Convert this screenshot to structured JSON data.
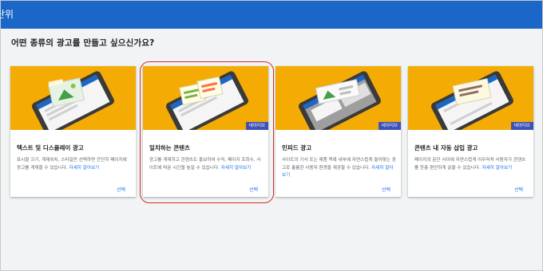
{
  "topbar": {
    "title": "단위"
  },
  "question": "어떤 종류의 광고를 만들고 싶으신가요?",
  "cards": [
    {
      "title": "텍스트 및 디스플레이 광고",
      "desc": "표시할 크기, 게재위치, 스타일만 선택하면 간단히 페이지에 광고를 게재할 수 있습니다.",
      "more": "자세히 알아보기",
      "select": "선택",
      "badge": ""
    },
    {
      "title": "일치하는 콘텐츠",
      "desc": "광고를 게재하고 콘텐츠도 홍보하여 수익, 페이지 조회수, 사이트에 머문 시간을 높일 수 있습니다.",
      "more": "자세히 알아보기",
      "select": "선택",
      "badge": "네이티브"
    },
    {
      "title": "인피드 광고",
      "desc": "사이트의 기사 또는 제품 목록 내부에 자연스럽게 들어맞는 광고로 훌륭한 사용자 환경을 제공할 수 있습니다.",
      "more": "자세히 알아보기",
      "select": "선택",
      "badge": "네이티브"
    },
    {
      "title": "콘텐츠 내 자동 삽입 광고",
      "desc": "페이지의 문단 사이에 자연스럽게 어우러져 사용자가 콘텐츠를 한층 편안하게 읽을 수 있습니다.",
      "more": "자세히 알아보기",
      "select": "선택",
      "badge": "네이티브"
    }
  ],
  "colors": {
    "topbar": "#1a67c8",
    "hero": "#f4ac05",
    "badge": "#3f51b5",
    "link": "#1a73e8",
    "highlight": "#d62b2b"
  }
}
